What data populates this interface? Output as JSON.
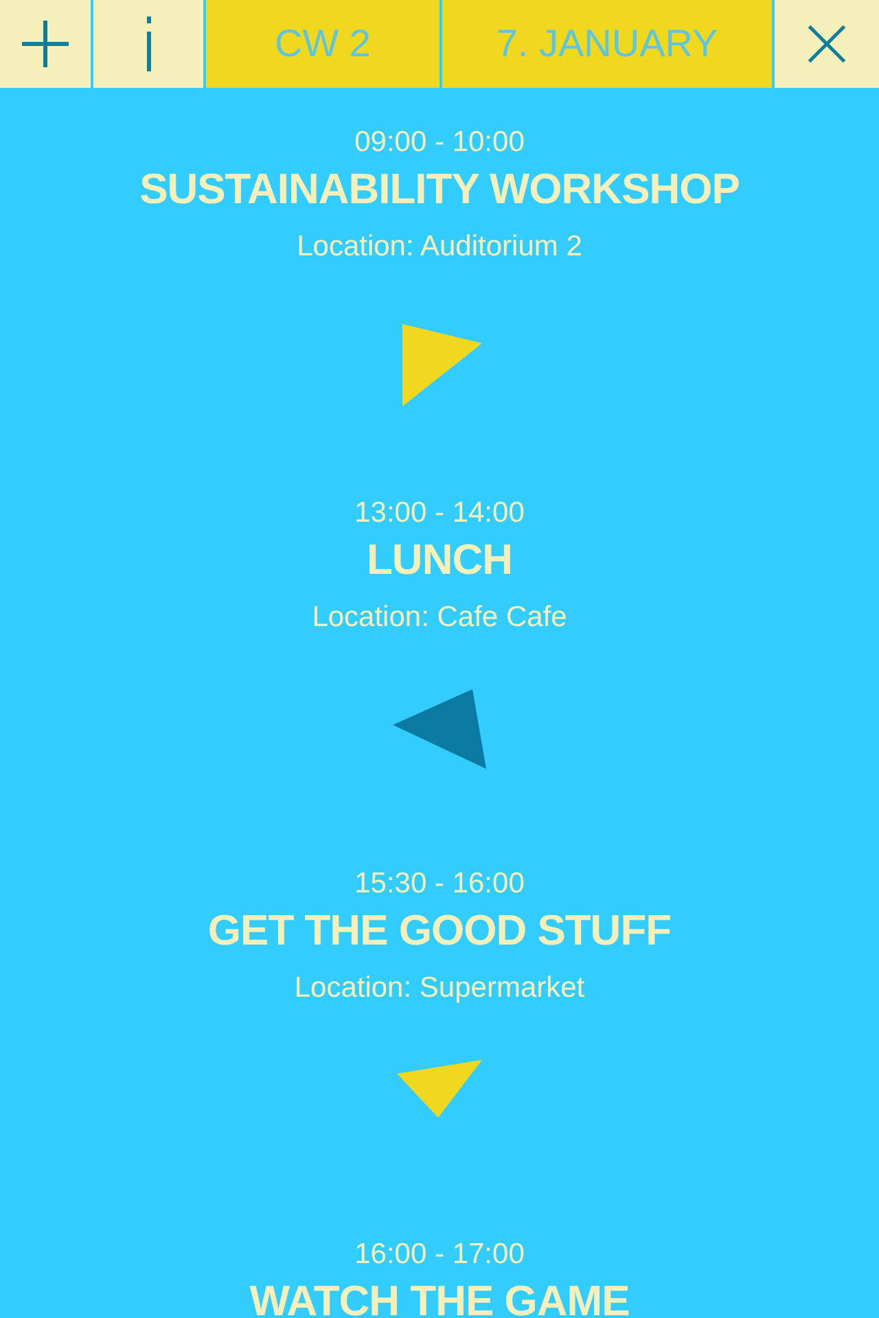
{
  "header": {
    "week": "CW 2",
    "date": "7. JANUARY"
  },
  "events": [
    {
      "time": "09:00 - 10:00",
      "title": "SUSTAINABILITY WORKSHOP",
      "location": "Location: Auditorium 2",
      "color": "#f0d81f"
    },
    {
      "time": "13:00 - 14:00",
      "title": "LUNCH",
      "location": "Location: Cafe Cafe",
      "color": "#0a7aa2"
    },
    {
      "time": "15:30 - 16:00",
      "title": "GET THE GOOD STUFF",
      "location": "Location: Supermarket",
      "color": "#f0d81f"
    },
    {
      "time": "16:00 - 17:00",
      "title": "WATCH THE GAME"
    }
  ]
}
